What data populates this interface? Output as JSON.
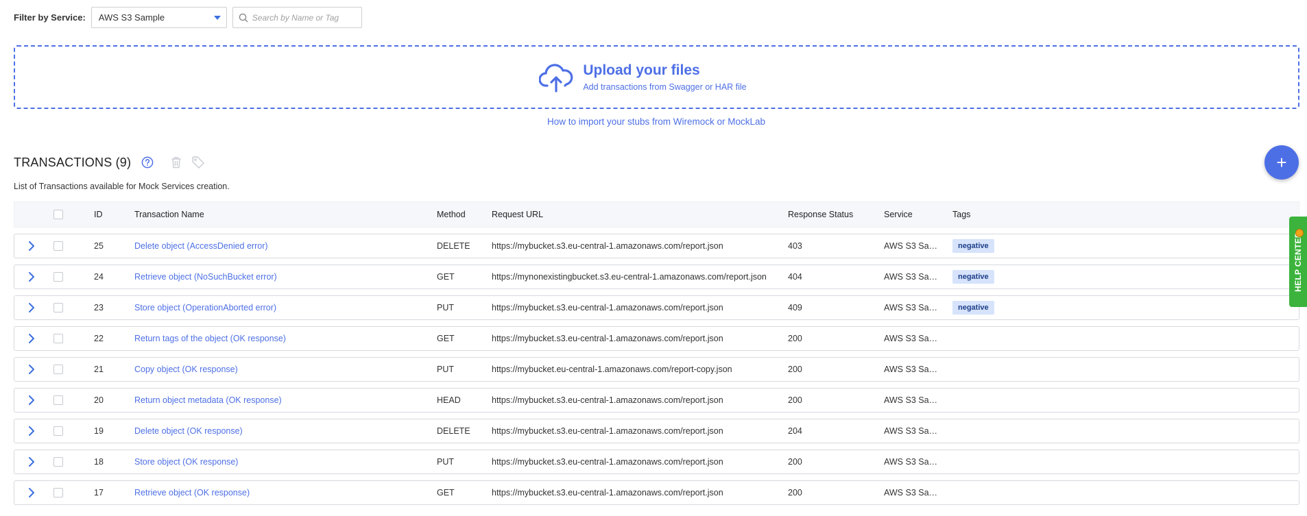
{
  "filter": {
    "label": "Filter by Service:",
    "service_value": "AWS S3 Sample",
    "search_placeholder": "Search by Name or Tag"
  },
  "upload": {
    "title": "Upload your files",
    "subtitle": "Add transactions from Swagger or HAR file",
    "import_link": "How to import your stubs from Wiremock or MockLab"
  },
  "transactions": {
    "title": "TRANSACTIONS (9)",
    "description": "List of Transactions available for Mock Services creation.",
    "add_label": "+",
    "columns": {
      "id": "ID",
      "name": "Transaction Name",
      "method": "Method",
      "url": "Request URL",
      "status": "Response Status",
      "service": "Service",
      "tags": "Tags"
    },
    "rows": [
      {
        "id": "25",
        "name": "Delete object (AccessDenied error)",
        "method": "DELETE",
        "url": "https://mybucket.s3.eu-central-1.amazonaws.com/report.json",
        "status": "403",
        "service": "AWS S3 Sample",
        "tag": "negative"
      },
      {
        "id": "24",
        "name": "Retrieve object (NoSuchBucket error)",
        "method": "GET",
        "url": "https://mynonexistingbucket.s3.eu-central-1.amazonaws.com/report.json",
        "status": "404",
        "service": "AWS S3 Sample",
        "tag": "negative"
      },
      {
        "id": "23",
        "name": "Store object (OperationAborted error)",
        "method": "PUT",
        "url": "https://mybucket.s3.eu-central-1.amazonaws.com/report.json",
        "status": "409",
        "service": "AWS S3 Sample",
        "tag": "negative"
      },
      {
        "id": "22",
        "name": "Return tags of the object (OK response)",
        "method": "GET",
        "url": "https://mybucket.s3.eu-central-1.amazonaws.com/report.json",
        "status": "200",
        "service": "AWS S3 Sample",
        "tag": ""
      },
      {
        "id": "21",
        "name": "Copy object (OK response)",
        "method": "PUT",
        "url": "https://mybucket.eu-central-1.amazonaws.com/report-copy.json",
        "status": "200",
        "service": "AWS S3 Sample",
        "tag": ""
      },
      {
        "id": "20",
        "name": "Return object metadata (OK response)",
        "method": "HEAD",
        "url": "https://mybucket.s3.eu-central-1.amazonaws.com/report.json",
        "status": "200",
        "service": "AWS S3 Sample",
        "tag": ""
      },
      {
        "id": "19",
        "name": "Delete object (OK response)",
        "method": "DELETE",
        "url": "https://mybucket.s3.eu-central-1.amazonaws.com/report.json",
        "status": "204",
        "service": "AWS S3 Sample",
        "tag": ""
      },
      {
        "id": "18",
        "name": "Store object (OK response)",
        "method": "PUT",
        "url": "https://mybucket.s3.eu-central-1.amazonaws.com/report.json",
        "status": "200",
        "service": "AWS S3 Sample",
        "tag": ""
      },
      {
        "id": "17",
        "name": "Retrieve object (OK response)",
        "method": "GET",
        "url": "https://mybucket.s3.eu-central-1.amazonaws.com/report.json",
        "status": "200",
        "service": "AWS S3 Sample",
        "tag": ""
      }
    ]
  },
  "help_center": {
    "label": "HELP CENTER"
  },
  "colors": {
    "accent": "#4d6fe6",
    "tag_bg": "#d6e3fb",
    "help_green": "#3cb33c"
  },
  "icons": [
    "chevron-down-icon",
    "search-icon",
    "cloud-upload-icon",
    "help-circle-icon",
    "trash-icon",
    "tag-icon",
    "plus-icon",
    "chevron-right-icon"
  ]
}
